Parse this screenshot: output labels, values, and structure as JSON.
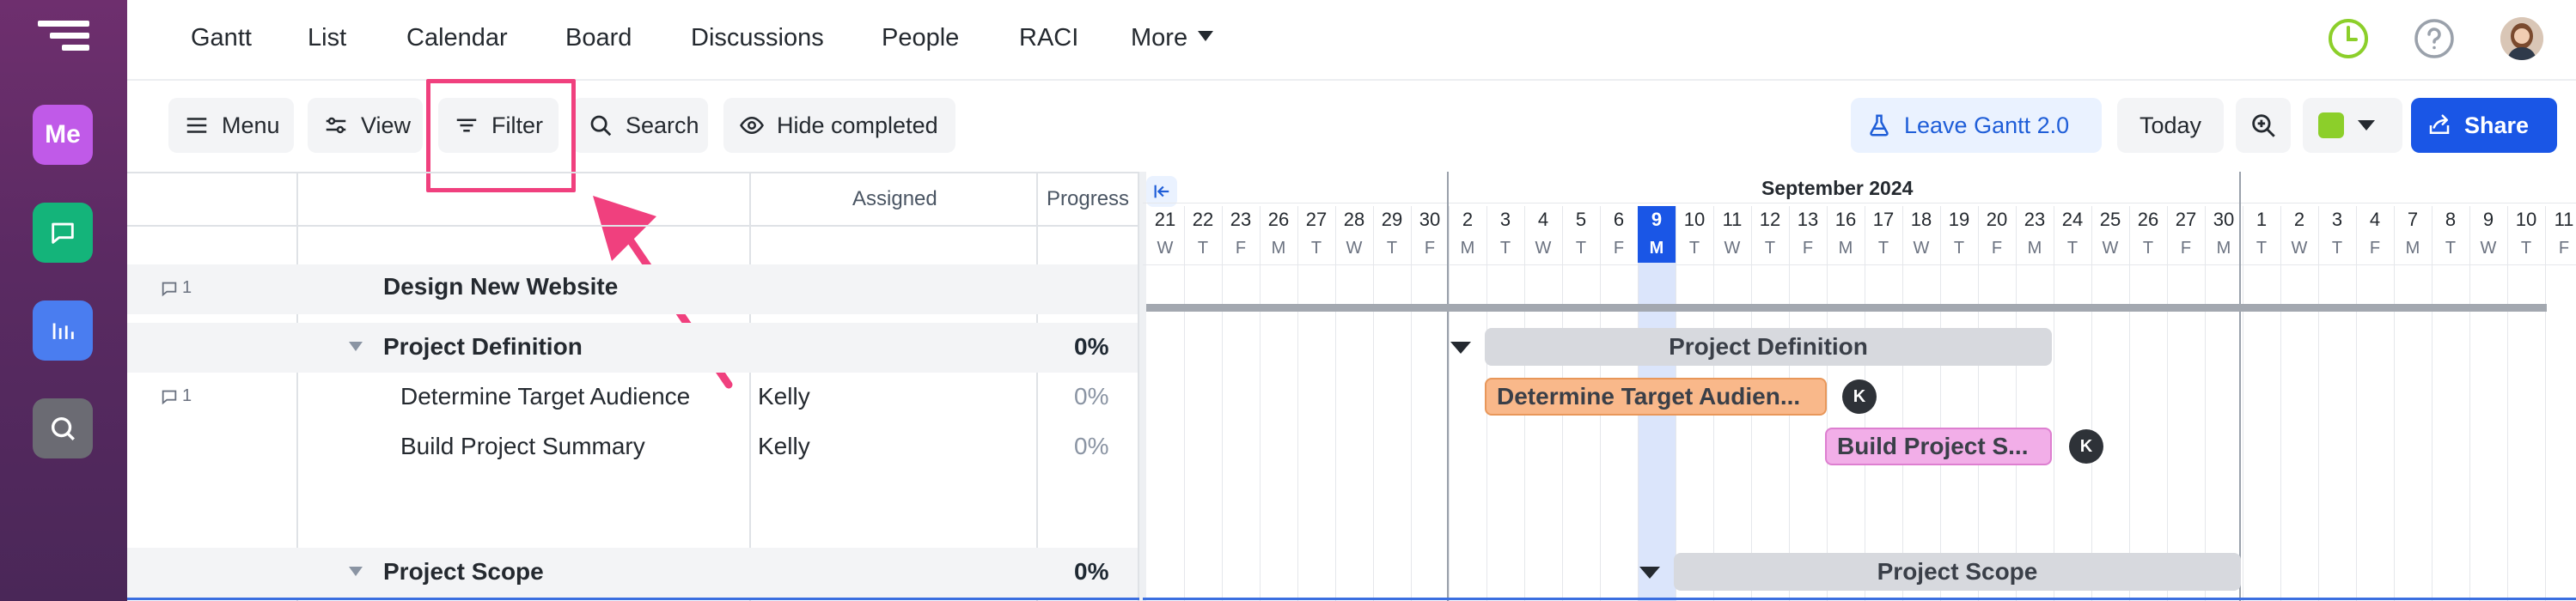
{
  "nav": {
    "tabs": [
      "Gantt",
      "List",
      "Calendar",
      "Board",
      "Discussions",
      "People",
      "RACI",
      "More"
    ]
  },
  "rail": {
    "me_label": "Me"
  },
  "toolbar": {
    "menu": "Menu",
    "view": "View",
    "filter": "Filter",
    "search": "Search",
    "hide_completed": "Hide completed",
    "leave_gantt": "Leave Gantt 2.0",
    "today": "Today",
    "share": "Share"
  },
  "columns": {
    "assigned": "Assigned",
    "progress": "Progress"
  },
  "rows": [
    {
      "comments": "1",
      "name": "Design New Website",
      "assigned": "",
      "progress": ""
    },
    {
      "comments": "",
      "name": "Project Definition",
      "assigned": "",
      "progress": "0%"
    },
    {
      "comments": "1",
      "name": "Determine Target Audience",
      "assigned": "Kelly",
      "progress": "0%"
    },
    {
      "comments": "",
      "name": "Build Project Summary",
      "assigned": "Kelly",
      "progress": "0%"
    },
    {
      "comments": "",
      "name": "Project Scope",
      "assigned": "",
      "progress": "0%"
    }
  ],
  "timeline": {
    "month": "September 2024",
    "days": [
      {
        "d": "21",
        "w": "W"
      },
      {
        "d": "22",
        "w": "T"
      },
      {
        "d": "23",
        "w": "F"
      },
      {
        "d": "26",
        "w": "M"
      },
      {
        "d": "27",
        "w": "T"
      },
      {
        "d": "28",
        "w": "W"
      },
      {
        "d": "29",
        "w": "T"
      },
      {
        "d": "30",
        "w": "F"
      },
      {
        "d": "2",
        "w": "M"
      },
      {
        "d": "3",
        "w": "T"
      },
      {
        "d": "4",
        "w": "W"
      },
      {
        "d": "5",
        "w": "T"
      },
      {
        "d": "6",
        "w": "F"
      },
      {
        "d": "9",
        "w": "M"
      },
      {
        "d": "10",
        "w": "T"
      },
      {
        "d": "11",
        "w": "W"
      },
      {
        "d": "12",
        "w": "T"
      },
      {
        "d": "13",
        "w": "F"
      },
      {
        "d": "16",
        "w": "M"
      },
      {
        "d": "17",
        "w": "T"
      },
      {
        "d": "18",
        "w": "W"
      },
      {
        "d": "19",
        "w": "T"
      },
      {
        "d": "20",
        "w": "F"
      },
      {
        "d": "23",
        "w": "M"
      },
      {
        "d": "24",
        "w": "T"
      },
      {
        "d": "25",
        "w": "W"
      },
      {
        "d": "26",
        "w": "T"
      },
      {
        "d": "27",
        "w": "F"
      },
      {
        "d": "30",
        "w": "M"
      },
      {
        "d": "1",
        "w": "T"
      },
      {
        "d": "2",
        "w": "W"
      },
      {
        "d": "3",
        "w": "T"
      },
      {
        "d": "4",
        "w": "F"
      },
      {
        "d": "7",
        "w": "M"
      },
      {
        "d": "8",
        "w": "T"
      },
      {
        "d": "9",
        "w": "W"
      },
      {
        "d": "10",
        "w": "T"
      },
      {
        "d": "11",
        "w": "F"
      }
    ],
    "today_index": 13
  },
  "bars": {
    "project_definition": "Project Definition",
    "determine_target": "Determine Target Audien...",
    "build_summary": "Build Project S...",
    "project_scope": "Project Scope",
    "assignee_initial": "K"
  },
  "colors": {
    "accent": "#1a56e6",
    "highlight": "#f0407e",
    "bar_orange": "#f9b88a",
    "bar_pink": "#f2aee8",
    "bar_gray": "#d7d9de"
  }
}
